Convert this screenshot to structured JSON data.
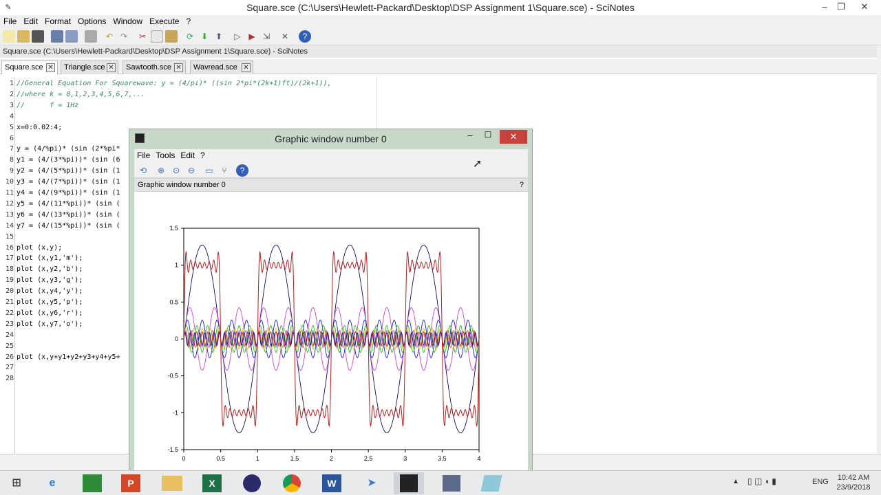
{
  "window": {
    "title": "Square.sce (C:\\Users\\Hewlett-Packard\\Desktop\\DSP Assignment 1\\Square.sce) - SciNotes",
    "path_bar": "Square.sce (C:\\Users\\Hewlett-Packard\\Desktop\\DSP Assignment 1\\Square.sce) - SciNotes"
  },
  "menu": [
    "File",
    "Edit",
    "Format",
    "Options",
    "Window",
    "Execute",
    "?"
  ],
  "tabs": [
    "Square.sce",
    "Triangle.sce",
    "Sawtooth.sce",
    "Wavread.sce"
  ],
  "code_lines": [
    {
      "n": "1",
      "text": "//General Equation For Squarewave: y = (4/pi)* ((sin 2*pi*(2k+1)ft)/(2k+1)),",
      "kind": "comment"
    },
    {
      "n": "2",
      "text": "//where k = 0,1,2,3,4,5,6,7,...",
      "kind": "comment"
    },
    {
      "n": "3",
      "text": "//      f = 1Hz",
      "kind": "comment"
    },
    {
      "n": "4",
      "text": "",
      "kind": "code"
    },
    {
      "n": "5",
      "text": "x=0:0.02:4;",
      "kind": "code"
    },
    {
      "n": "6",
      "text": "",
      "kind": "code"
    },
    {
      "n": "7",
      "text": "y = (4/%pi)* (sin (2*%pi*",
      "kind": "code"
    },
    {
      "n": "8",
      "text": "y1 = (4/(3*%pi))* (sin (6",
      "kind": "code"
    },
    {
      "n": "9",
      "text": "y2 = (4/(5*%pi))* (sin (1",
      "kind": "code"
    },
    {
      "n": "10",
      "text": "y3 = (4/(7*%pi))* (sin (1",
      "kind": "code"
    },
    {
      "n": "11",
      "text": "y4 = (4/(9*%pi))* (sin (1",
      "kind": "code"
    },
    {
      "n": "12",
      "text": "y5 = (4/(11*%pi))* (sin (",
      "kind": "code"
    },
    {
      "n": "13",
      "text": "y6 = (4/(13*%pi))* (sin (",
      "kind": "code"
    },
    {
      "n": "14",
      "text": "y7 = (4/(15*%pi))* (sin (",
      "kind": "code"
    },
    {
      "n": "15",
      "text": "",
      "kind": "code"
    },
    {
      "n": "16",
      "text": "plot (x,y);",
      "kind": "code"
    },
    {
      "n": "17",
      "text": "plot (x,y1,'m');",
      "kind": "code"
    },
    {
      "n": "18",
      "text": "plot (x,y2,'b');",
      "kind": "code"
    },
    {
      "n": "19",
      "text": "plot (x,y3,'g');",
      "kind": "code"
    },
    {
      "n": "20",
      "text": "plot (x,y4,'y');",
      "kind": "code"
    },
    {
      "n": "21",
      "text": "plot (x,y5,'p');",
      "kind": "code"
    },
    {
      "n": "22",
      "text": "plot (x,y6,'r');",
      "kind": "code"
    },
    {
      "n": "23",
      "text": "plot (x,y7,'o');",
      "kind": "code"
    },
    {
      "n": "24",
      "text": "",
      "kind": "code"
    },
    {
      "n": "25",
      "text": "",
      "kind": "code"
    },
    {
      "n": "26",
      "text": "plot (x,y+y1+y2+y3+y4+y5+",
      "kind": "code"
    },
    {
      "n": "27",
      "text": "",
      "kind": "code"
    },
    {
      "n": "28",
      "text": "",
      "kind": "code"
    }
  ],
  "graphic_window": {
    "title": "Graphic window number 0",
    "menu": [
      "File",
      "Tools",
      "Edit",
      "?"
    ],
    "label": "Graphic window number 0",
    "help": "?"
  },
  "chart_data": {
    "type": "line",
    "xlim": [
      0,
      4
    ],
    "ylim": [
      -1.5,
      1.5
    ],
    "x_ticks": [
      "0",
      "0.5",
      "1",
      "1.5",
      "2",
      "2.5",
      "3",
      "3.5",
      "4"
    ],
    "y_ticks": [
      "1.5",
      "1",
      "0.5",
      "0",
      "-0.5",
      "-1",
      "-1.5"
    ],
    "frequency": 1,
    "series": [
      {
        "harmonic": 1,
        "color": "#0a0a60"
      },
      {
        "harmonic": 3,
        "color": "#cc44cc"
      },
      {
        "harmonic": 5,
        "color": "#1a1ad8"
      },
      {
        "harmonic": 7,
        "color": "#22bb22"
      },
      {
        "harmonic": 9,
        "color": "#cccc22"
      },
      {
        "harmonic": 11,
        "color": "#aa66cc"
      },
      {
        "harmonic": 13,
        "color": "#cc2222"
      },
      {
        "harmonic": 15,
        "color": "#1a1a90"
      },
      {
        "harmonic": "sum",
        "color": "#b41e1e"
      }
    ]
  },
  "taskbar": {
    "time": "10:42 AM",
    "date": "23/9/2018",
    "lang": "ENG"
  },
  "colors": {
    "accent_close": "#c7423a",
    "window_frame": "#c8d8c8"
  }
}
